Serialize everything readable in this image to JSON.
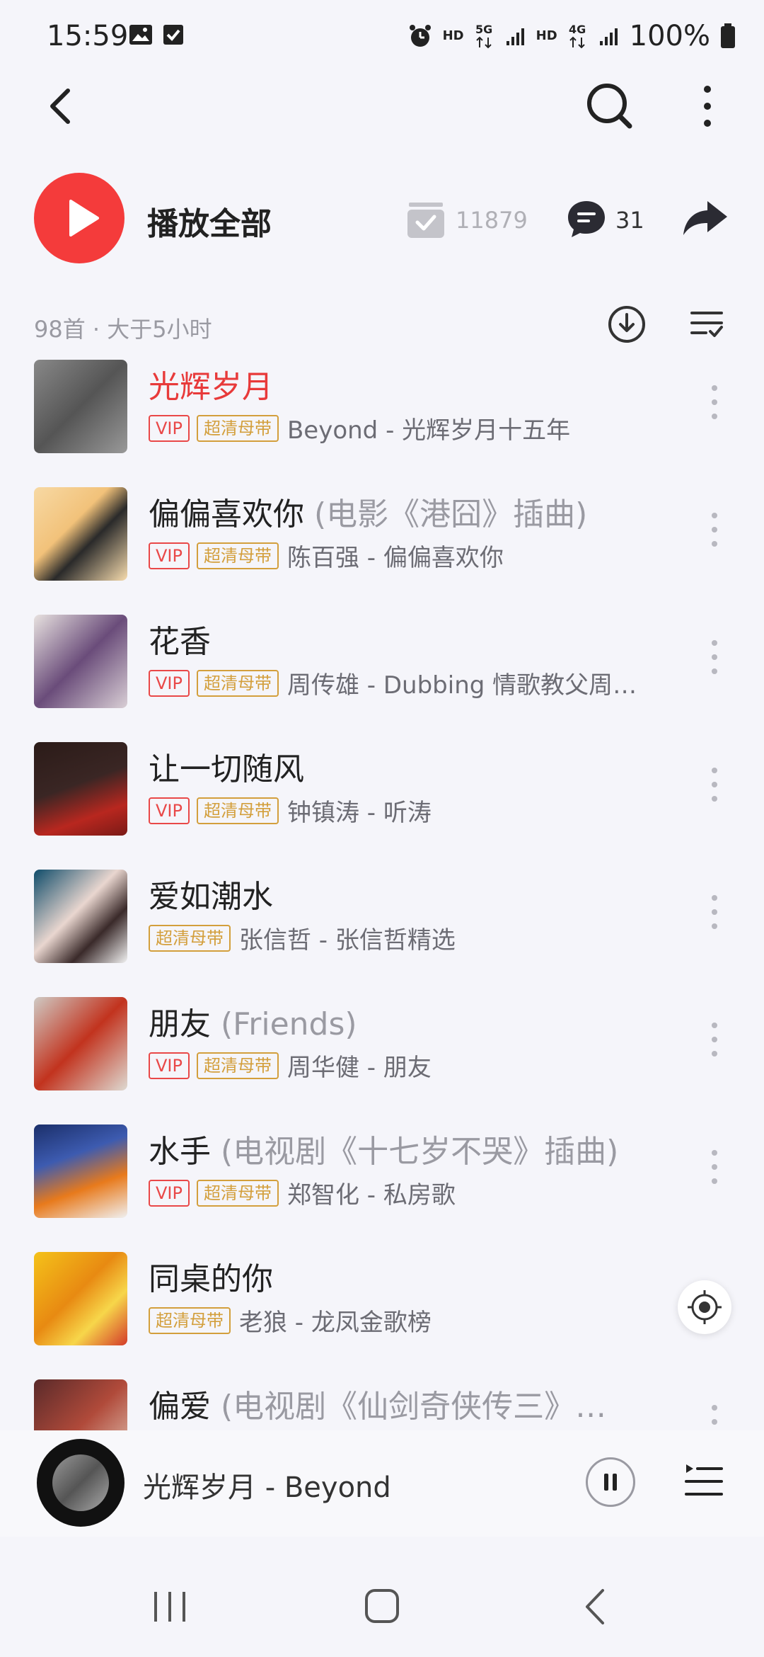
{
  "status_bar": {
    "time": "15:59",
    "battery": "100%",
    "icons": [
      "image-icon",
      "check-icon",
      "alarm-icon",
      "hd-icon",
      "5g-icon",
      "signal-icon",
      "hd-icon",
      "4g-icon",
      "signal-icon",
      "battery-icon"
    ]
  },
  "topbar": {
    "icons": [
      "back-icon",
      "search-icon",
      "more-vertical-icon"
    ]
  },
  "play_all": {
    "label": "播放全部",
    "collect_count": "11879",
    "comment_count": "31"
  },
  "meta": {
    "summary": "98首 · 大于5小时"
  },
  "badges": {
    "vip": "VIP",
    "hq": "超清母带"
  },
  "songs": [
    {
      "title": "光辉岁月",
      "suffix": "",
      "artist": "Beyond - 光辉岁月十五年",
      "vip": true,
      "hq": true,
      "active": true
    },
    {
      "title": "偏偏喜欢你",
      "suffix": " (电影《港囧》插曲)",
      "artist": "陈百强 - 偏偏喜欢你",
      "vip": true,
      "hq": true
    },
    {
      "title": "花香",
      "suffix": "",
      "artist": "周传雄 - Dubbing 情歌教父周传…",
      "vip": true,
      "hq": true
    },
    {
      "title": "让一切随风",
      "suffix": "",
      "artist": "钟镇涛 - 听涛",
      "vip": true,
      "hq": true
    },
    {
      "title": "爱如潮水",
      "suffix": "",
      "artist": "张信哲 - 张信哲精选",
      "vip": false,
      "hq": true
    },
    {
      "title": "朋友",
      "suffix": " (Friends)",
      "artist": "周华健 - 朋友",
      "vip": true,
      "hq": true
    },
    {
      "title": "水手",
      "suffix": " (电视剧《十七岁不哭》插曲)",
      "artist": "郑智化 - 私房歌",
      "vip": true,
      "hq": true
    },
    {
      "title": "同桌的你",
      "suffix": "",
      "artist": "老狼 - 龙凤金歌榜",
      "vip": false,
      "hq": true
    },
    {
      "title": "偏爱",
      "suffix": " (电视剧《仙剑奇侠传三》…",
      "artist": "",
      "vip": false,
      "hq": false
    }
  ],
  "mini_player": {
    "title": "光辉岁月 - Beyond"
  },
  "colors": {
    "accent": "#f43b3b",
    "vip": "#e94848",
    "hq": "#d39f3c",
    "background": "#f5f5fa"
  }
}
